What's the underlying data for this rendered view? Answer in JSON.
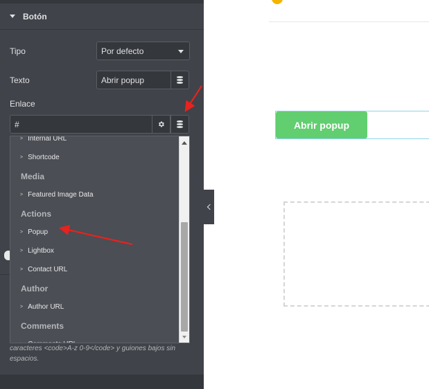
{
  "panel": {
    "section_title": "Botón",
    "tipo": {
      "label": "Tipo",
      "value": "Por defecto"
    },
    "texto": {
      "label": "Texto",
      "value": "Abrir popup"
    },
    "enlace": {
      "label": "Enlace",
      "value": "#"
    },
    "icons": {
      "dynamic_tags": "database-icon",
      "link_options": "gear-icon",
      "collapse": "chevron-left-icon"
    },
    "help_text": "caracteres <code>A-z 0-9</code> y guiones bajos sin espacios."
  },
  "dropdown": {
    "items": [
      {
        "type": "item",
        "label": "Internal URL"
      },
      {
        "type": "item",
        "label": "Shortcode"
      },
      {
        "type": "group",
        "label": "Media"
      },
      {
        "type": "item",
        "label": "Featured Image Data"
      },
      {
        "type": "group",
        "label": "Actions"
      },
      {
        "type": "item",
        "label": "Popup"
      },
      {
        "type": "item",
        "label": "Lightbox"
      },
      {
        "type": "item",
        "label": "Contact URL"
      },
      {
        "type": "group",
        "label": "Author"
      },
      {
        "type": "item",
        "label": "Author URL"
      },
      {
        "type": "group",
        "label": "Comments"
      },
      {
        "type": "item",
        "label": "Comments URL"
      }
    ],
    "chevron": ">"
  },
  "preview": {
    "button_label": "Abrir popup",
    "button_color": "#61ce70"
  },
  "colors": {
    "panel_bg": "#404349",
    "annotation_arrow": "#e8221e"
  }
}
